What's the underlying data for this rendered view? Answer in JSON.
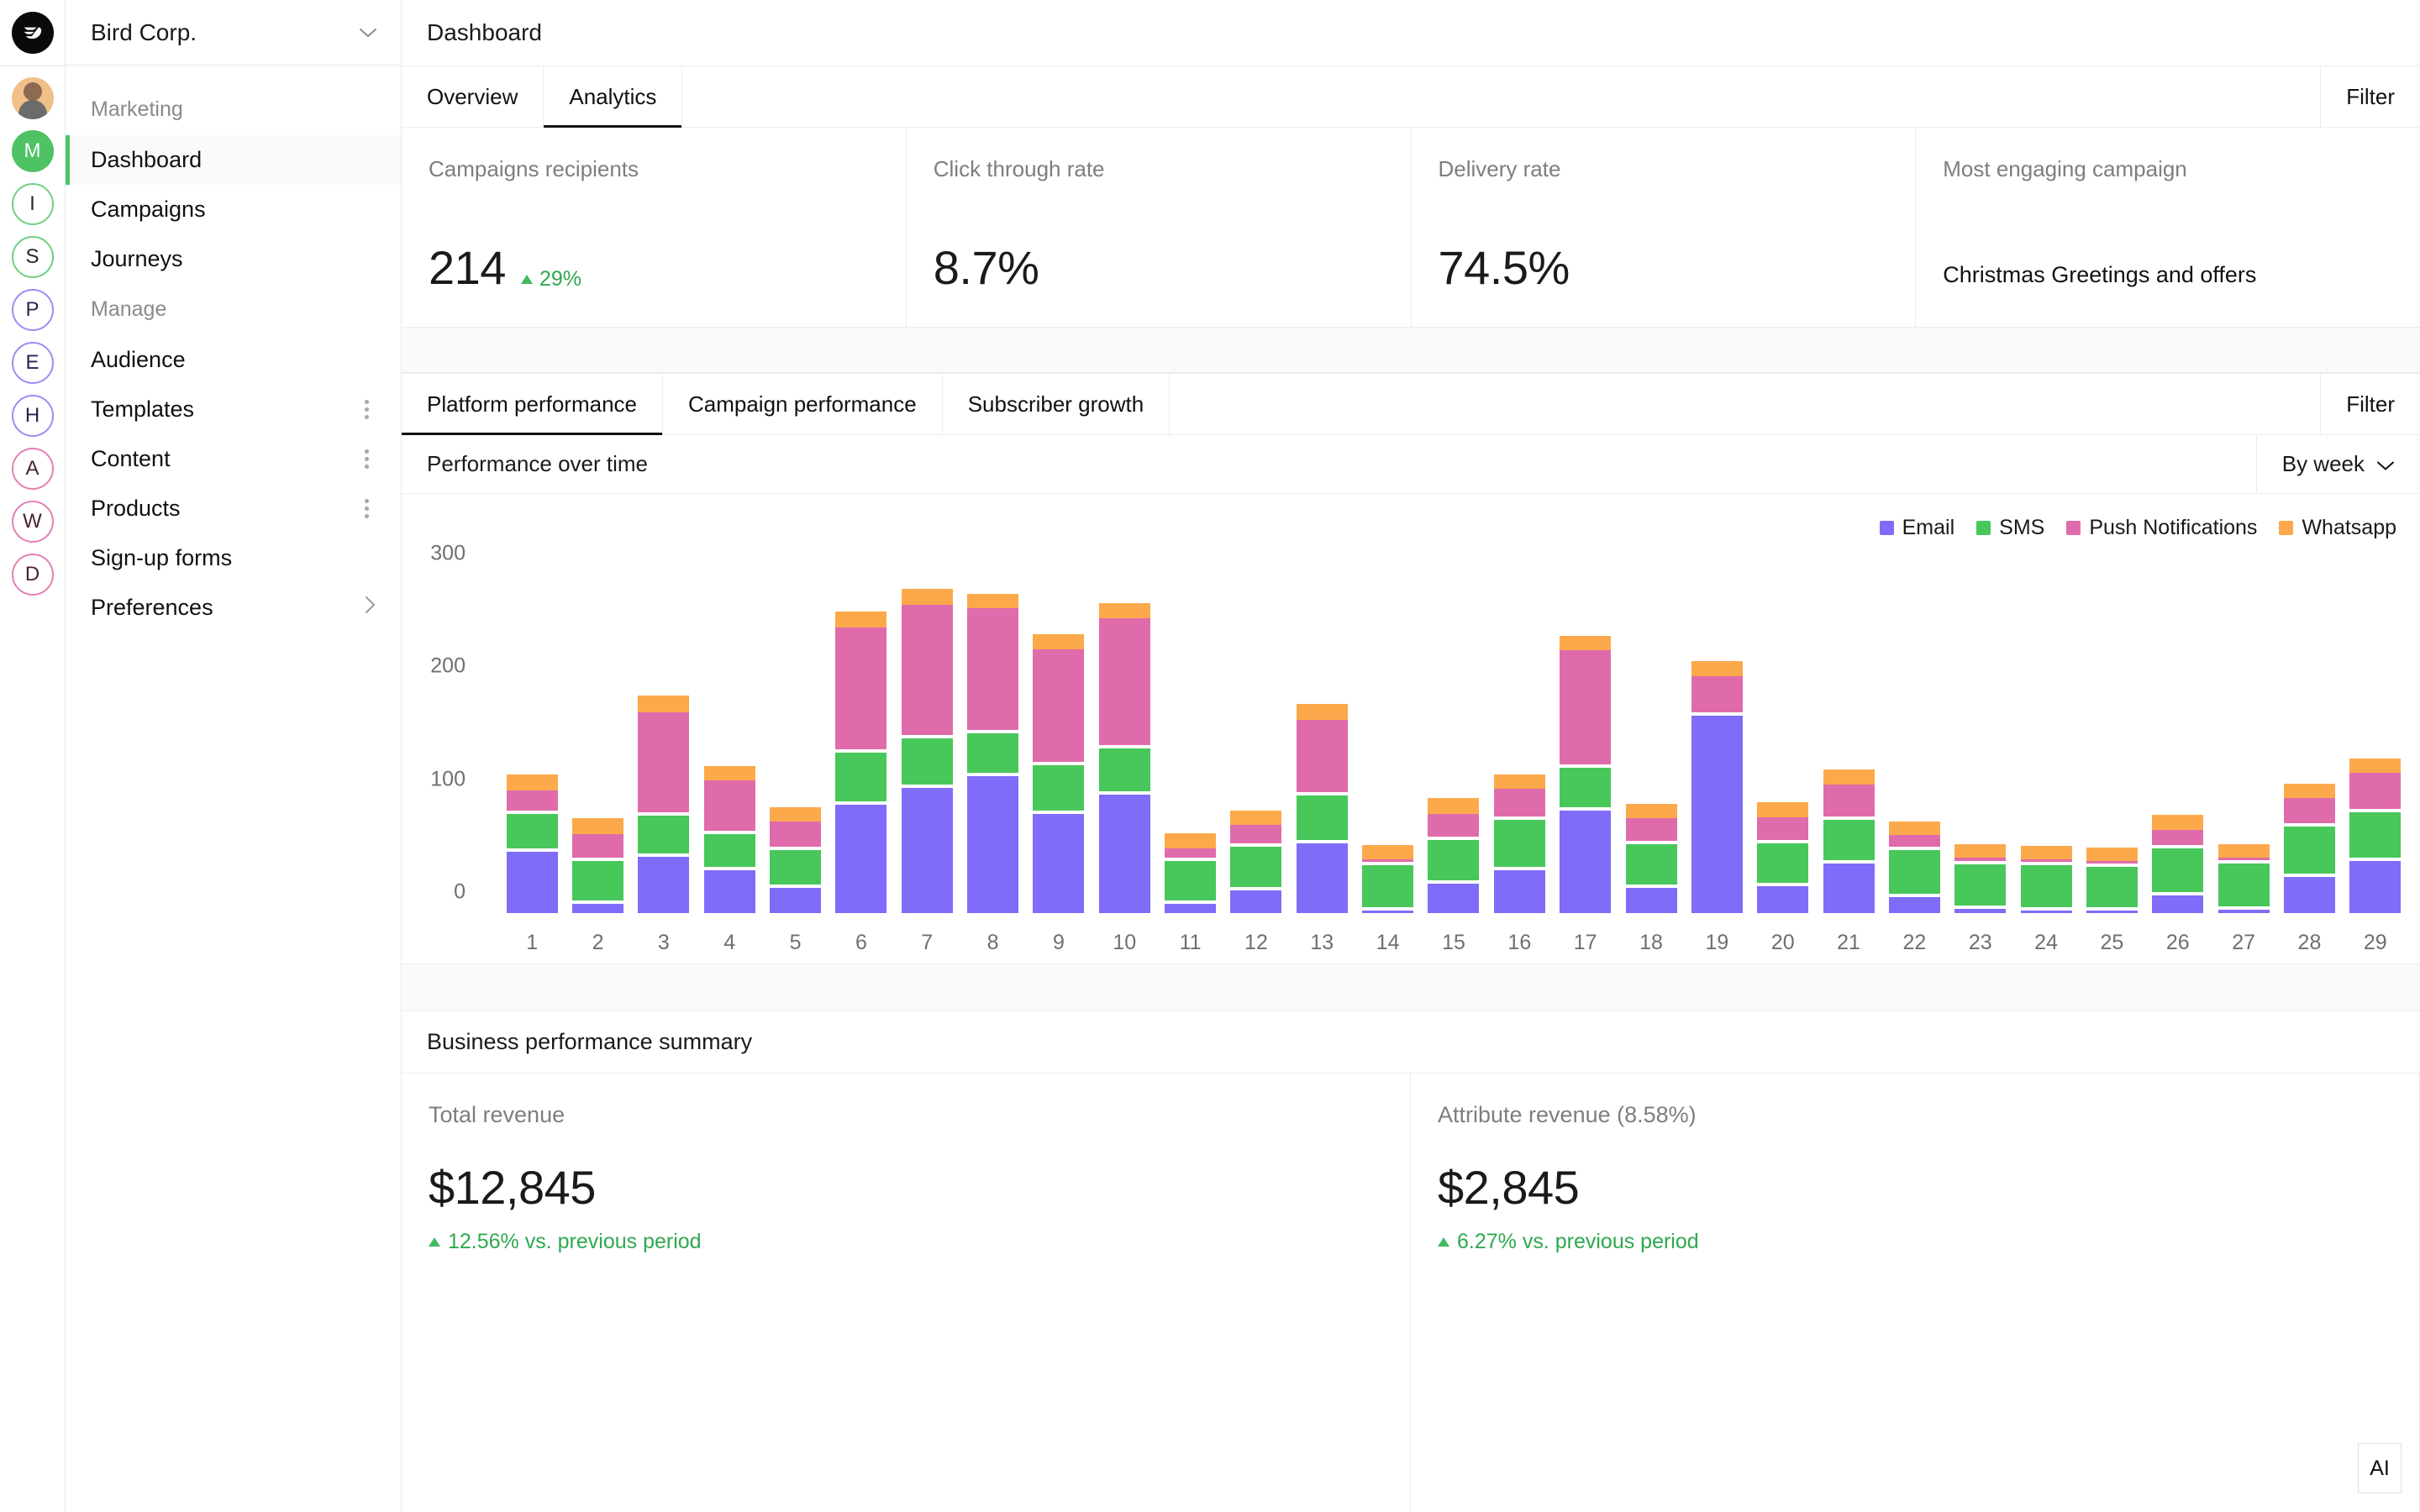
{
  "rail": {
    "logo_icon": "bird-logo-icon",
    "avatar_icon": "user-avatar",
    "items": [
      {
        "letter": "M",
        "style": "filled"
      },
      {
        "letter": "I",
        "style": "g"
      },
      {
        "letter": "S",
        "style": "g"
      },
      {
        "letter": "P",
        "style": "p"
      },
      {
        "letter": "E",
        "style": "p"
      },
      {
        "letter": "H",
        "style": "p"
      },
      {
        "letter": "A",
        "style": "k"
      },
      {
        "letter": "W",
        "style": "k"
      },
      {
        "letter": "D",
        "style": "k"
      }
    ]
  },
  "sidebar": {
    "org_name": "Bird Corp.",
    "groups": [
      {
        "label": "Marketing",
        "items": [
          {
            "label": "Dashboard",
            "active": true,
            "trailing": "none"
          },
          {
            "label": "Campaigns",
            "active": false,
            "trailing": "none"
          },
          {
            "label": "Journeys",
            "active": false,
            "trailing": "none"
          }
        ]
      },
      {
        "label": "Manage",
        "items": [
          {
            "label": "Audience",
            "active": false,
            "trailing": "none"
          },
          {
            "label": "Templates",
            "active": false,
            "trailing": "kebab"
          },
          {
            "label": "Content",
            "active": false,
            "trailing": "kebab"
          },
          {
            "label": "Products",
            "active": false,
            "trailing": "kebab"
          },
          {
            "label": "Sign-up forms",
            "active": false,
            "trailing": "none"
          },
          {
            "label": "Preferences",
            "active": false,
            "trailing": "arrow"
          }
        ]
      }
    ]
  },
  "header": {
    "title": "Dashboard"
  },
  "top_tabs": {
    "tabs": [
      {
        "label": "Overview",
        "active": false
      },
      {
        "label": "Analytics",
        "active": true
      }
    ],
    "filter_label": "Filter"
  },
  "kpis": [
    {
      "label": "Campaigns recipients",
      "value": "214",
      "delta": "29%",
      "trend": "up",
      "kind": "number"
    },
    {
      "label": "Click through rate",
      "value": "8.7%",
      "kind": "number"
    },
    {
      "label": "Delivery rate",
      "value": "74.5%",
      "kind": "number"
    },
    {
      "label": "Most engaging campaign",
      "value": "Christmas Greetings and offers",
      "kind": "text"
    }
  ],
  "chart_tabs": {
    "tabs": [
      {
        "label": "Platform performance",
        "active": true
      },
      {
        "label": "Campaign performance",
        "active": false
      },
      {
        "label": "Subscriber growth",
        "active": false
      }
    ],
    "filter_label": "Filter"
  },
  "chart_header": {
    "title": "Performance over time",
    "granularity": "By week",
    "granularity_icon": "chevron-down-icon"
  },
  "colors": {
    "email": "#7f6cf9",
    "sms": "#48c75a",
    "push": "#e06bab",
    "whatsapp": "#fca94b",
    "accent_green": "#4fc263",
    "positive": "#2fa84f"
  },
  "chart_data": {
    "type": "bar",
    "stacked": true,
    "title": "Performance over time",
    "xlabel": "",
    "ylabel": "",
    "ylim": [
      0,
      320
    ],
    "yticks": [
      0,
      100,
      200,
      300
    ],
    "grid": false,
    "legend_position": "top-right",
    "categories": [
      "1",
      "2",
      "3",
      "4",
      "5",
      "6",
      "7",
      "8",
      "9",
      "10",
      "11",
      "12",
      "13",
      "14",
      "15",
      "16",
      "17",
      "18",
      "19",
      "20",
      "21",
      "22",
      "23",
      "24",
      "25",
      "26",
      "27",
      "28",
      "29"
    ],
    "series": [
      {
        "name": "Email",
        "color": "#7f6cf9",
        "values": [
          54,
          8,
          50,
          38,
          22,
          96,
          111,
          121,
          88,
          105,
          8,
          20,
          62,
          2,
          26,
          38,
          91,
          22,
          175,
          24,
          44,
          14,
          4,
          2,
          2,
          16,
          3,
          32,
          46
        ]
      },
      {
        "name": "SMS",
        "color": "#48c75a",
        "values": [
          31,
          35,
          33,
          29,
          31,
          43,
          41,
          35,
          40,
          38,
          35,
          36,
          39,
          37,
          36,
          42,
          35,
          36,
          0,
          35,
          36,
          39,
          36,
          37,
          36,
          38,
          38,
          42,
          40
        ]
      },
      {
        "name": "Push Notifications",
        "color": "#e06bab",
        "values": [
          18,
          21,
          89,
          45,
          22,
          108,
          115,
          108,
          100,
          112,
          8,
          16,
          64,
          2,
          20,
          24,
          101,
          20,
          32,
          20,
          28,
          10,
          3,
          2,
          2,
          14,
          2,
          22,
          32
        ]
      },
      {
        "name": "Whatsapp",
        "color": "#fca94b",
        "values": [
          14,
          14,
          15,
          12,
          13,
          14,
          14,
          13,
          13,
          14,
          14,
          13,
          14,
          13,
          14,
          13,
          13,
          13,
          13,
          13,
          13,
          12,
          12,
          12,
          12,
          13,
          12,
          13,
          13
        ]
      }
    ],
    "legend": [
      {
        "label": "Email",
        "color": "#7f6cf9"
      },
      {
        "label": "SMS",
        "color": "#48c75a"
      },
      {
        "label": "Push Notifications",
        "color": "#e06bab"
      },
      {
        "label": "Whatsapp",
        "color": "#fca94b"
      }
    ]
  },
  "business": {
    "section_title": "Business performance summary",
    "cells": [
      {
        "label": "Total revenue",
        "value": "$12,845",
        "delta": "12.56% vs. previous period",
        "trend": "up"
      },
      {
        "label": "Attribute revenue (8.58%)",
        "value": "$2,845",
        "delta": "6.27% vs. previous period",
        "trend": "up"
      }
    ],
    "ai_button": "AI"
  }
}
